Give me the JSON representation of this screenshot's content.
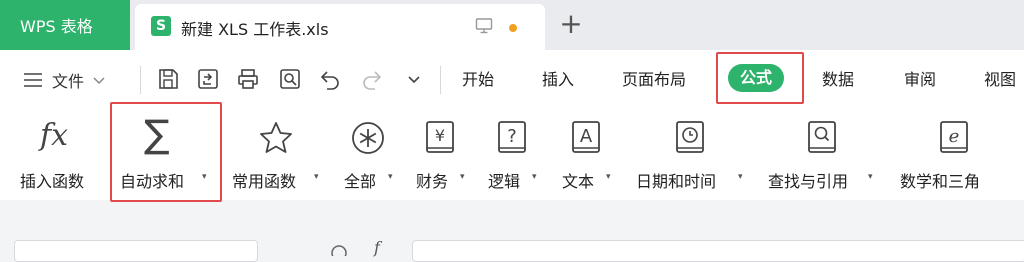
{
  "app": {
    "name": "WPS 表格",
    "brand_color": "#2db36c"
  },
  "document_tab": {
    "icon_letter": "S",
    "title": "新建 XLS 工作表.xls",
    "new_tab_symbol": "+"
  },
  "menubar": {
    "file_label": "文件",
    "items": [
      {
        "label": "开始"
      },
      {
        "label": "插入"
      },
      {
        "label": "页面布局"
      },
      {
        "label": "公式",
        "active": true
      },
      {
        "label": "数据"
      },
      {
        "label": "审阅"
      },
      {
        "label": "视图"
      }
    ]
  },
  "ribbon": {
    "insert_function": {
      "icon_text": "fx",
      "label": "插入函数"
    },
    "buttons": [
      {
        "label": "自动求和",
        "icon": "sigma-icon",
        "icon_text": "∑"
      },
      {
        "label": "常用函数",
        "icon": "star-icon"
      },
      {
        "label": "全部",
        "icon": "asterisk-circle-icon"
      },
      {
        "label": "财务",
        "icon": "book-yen-icon",
        "icon_text": "¥"
      },
      {
        "label": "逻辑",
        "icon": "book-question-icon",
        "icon_text": "?"
      },
      {
        "label": "文本",
        "icon": "book-text-icon",
        "icon_text": "A"
      },
      {
        "label": "日期和时间",
        "icon": "book-clock-icon"
      },
      {
        "label": "查找与引用",
        "icon": "book-search-icon"
      },
      {
        "label": "数学和三角",
        "icon": "book-math-icon",
        "icon_text": "e"
      }
    ],
    "caret": "▾"
  },
  "formula_bar": {
    "fx_icon_text": "f"
  },
  "highlight_color": "#e04a4a"
}
